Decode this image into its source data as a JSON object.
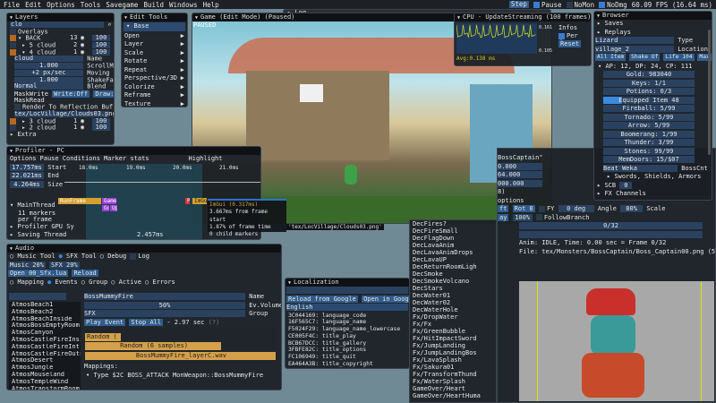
{
  "menu": {
    "items": [
      "File",
      "Edit",
      "Options",
      "Tools",
      "Savegame",
      "Build",
      "Windows",
      "Help"
    ],
    "step": "Step",
    "pause": "Pause",
    "nomon": "NoMon",
    "nodmg": "NoDmg",
    "fps": "60.09 FPS (16.64 ms)"
  },
  "layers": {
    "title": "Layers",
    "search": "clo",
    "overlays": "Overlays",
    "rows": [
      {
        "name": "BACK",
        "count": "13",
        "value": "100"
      },
      {
        "name": "5 cloud",
        "count": "2",
        "value": "100"
      },
      {
        "name": "4 cloud",
        "count": "1",
        "value": "100"
      }
    ],
    "name_val": "cloud",
    "name_lbl": "Name",
    "scroll_val": "1.000",
    "scroll_lbl": "ScrollMulX",
    "moving_val": "+2 px/sec",
    "moving_lbl": "Moving Spe",
    "shake_val": "1.000",
    "shake_lbl": "ShakeFacto",
    "blend_val": "Normal",
    "blend_lbl": "Blend",
    "maskwrite": "MaskWrite",
    "write_off": "Write:Off",
    "draw": "Draw:O",
    "maskread": "MaskRead",
    "render_reflection": "Render To Reflection Buffer",
    "texture": "tex/LocVillage/Clouds03.png",
    "rows2": [
      {
        "name": "3 cloud",
        "count": "1",
        "value": "100"
      },
      {
        "name": "2 cloud",
        "count": "1",
        "value": "100"
      }
    ],
    "extra": "Extra"
  },
  "edit_tools": {
    "title": "Edit Tools",
    "base": "Base",
    "items": [
      "Open",
      "Layer",
      "Scale",
      "Rotate",
      "Repeat",
      "Perspective/3D",
      "Colorize",
      "Reframe",
      "Texture",
      "Behavior"
    ]
  },
  "game": {
    "title": "Game (Edit Mode) (Paused)",
    "paused": "PAUSED",
    "log_tab": "Log"
  },
  "cpu": {
    "title": "CPU - UpdateStreaming (100 frames)",
    "max": "0.161",
    "min": "0.105",
    "avg": "Avg:0.138 ms",
    "infos": "Infos",
    "per_frame": "Per frame",
    "reset": "Reset",
    "color": "#c8d020"
  },
  "browser": {
    "title": "Browser",
    "saves": "Saves",
    "replays": "Replays",
    "type_val": "Lizard",
    "type_lbl": "Type",
    "loc_val": "village_2",
    "loc_lbl": "Location",
    "buttons": [
      "All Item",
      "Shake Of",
      "Life 104",
      "Max 104"
    ],
    "stats": "AP: 12, DP: 24, CP: 111",
    "items": [
      "Gold: 983040",
      "Keys: 1/1",
      "Potions: 0/3",
      "Equipped Item 48",
      "Fireball: 5/99",
      "Tornado: 5/99",
      "Arrow: 5/99",
      "Boomerang: 1/99",
      "Thunder: 3/99",
      "Stones: 99/99",
      "MemDoors: 15/$07"
    ],
    "boss_val": "Beat Weka",
    "boss_lbl": "BossCnt",
    "swords": "Swords, Shields, Armors",
    "scb": "SCB",
    "scb_val": "0",
    "fx": "FX Channels"
  },
  "profiler": {
    "title": "Profiler - PC",
    "menu": [
      "Options",
      "Pause Conditions",
      "Marker stats",
      "Highlight"
    ],
    "start": "17.757ms",
    "start_lbl": "Start",
    "end": "22.021ms",
    "end_lbl": "End",
    "size": "4.264ms",
    "size_lbl": "Size",
    "ticks": [
      "18.0ms",
      "19.0ms",
      "20.0ms",
      "21.0ms"
    ],
    "main_thread": "MainThread",
    "markers": "11 markers",
    "per_frame": "per frame",
    "gpu": "Profiler GPU Sy",
    "saving": "Saving Thread",
    "duration": "2.457ms",
    "bars": {
      "runframe": "RunFrame",
      "game": "Game",
      "goup": "Go",
      "up": "Up",
      "p": "P",
      "imgui": "ImGu"
    }
  },
  "tooltip": {
    "title": "ImGui (0.317ms)",
    "l1": "3.667ms from frame start",
    "l2": "1.87% of frame time",
    "l3": "0 child markers",
    "extra": "'tex/LocVillage/Clouds03.png'"
  },
  "audio": {
    "title": "Audio",
    "tabs": [
      "Music Tool",
      "SFX Tool",
      "Debug",
      "Log"
    ],
    "music": "Music 20%",
    "sfx": "SFX 20%",
    "open": "Open 00_Sfx.lua",
    "reload": "Reload",
    "modes": [
      "Mapping",
      "Events",
      "Group",
      "Active",
      "Errors"
    ],
    "search": "",
    "list": [
      "AtmosBeach1",
      "AtmosBeach2",
      "AtmosBeachInside",
      "AtmosBossEmptyRoom",
      "AtmosCanyon",
      "AtmosCastleFireInsi",
      "AtmosCastleFireIntr",
      "AtmosCastleFireOuts",
      "AtmosDesert",
      "AtmosJungle",
      "AtmosMouseland",
      "AtmosTempleWind",
      "AtmosTransformRoom"
    ],
    "name_val": "BossMummyFire",
    "name_lbl": "Name",
    "vol_val": "50%",
    "vol_lbl": "Ev.Volume",
    "group_val": "SFX",
    "group_lbl": "Group",
    "play": "Play Event",
    "stop": "Stop All",
    "time": "- 2.97 sec",
    "help": "(?)",
    "track1": "Random (",
    "track2": "Random (6 samples)",
    "track3": "BossMummyFire_layerC.wav",
    "mappings": "Mappings:",
    "mapping": "Type $2C BOSS_ATTACK    MonWeapon::BossMummyFire",
    "track_color": "#d4a04a"
  },
  "localization": {
    "title": "Localization",
    "reload": "Reload from Google",
    "open": "Open in Google",
    "lang": "English",
    "rows": [
      [
        "3C044169:",
        "language_code"
      ],
      [
        "16F565C7:",
        "language_name"
      ],
      [
        "F5024F29:",
        "language_name_lowercase"
      ],
      [
        "CE005F4C:",
        "title_play"
      ],
      [
        "BCB67DCC:",
        "title_gallery"
      ],
      [
        "3FBFE82C:",
        "title_options"
      ],
      [
        "FC106949:",
        "title_quit"
      ],
      [
        "EA464A3B:",
        "title_copyright"
      ]
    ]
  },
  "sprites": {
    "list": [
      "DecFires?",
      "DecFireSmall",
      "DecFlagDown",
      "DecLavaAnim",
      "DecLavaAnimDrops",
      "DecLavaUP",
      "DecReturnRoomLigh",
      "DecSmoke",
      "DecSmokeVolcano",
      "DecStars",
      "DecWater01",
      "DecWater02",
      "DecWaterHole",
      "Fx/DropWater",
      "Fx/Fx",
      "Fx/GreenBubble",
      "Fx/HitImpactSword",
      "Fx/JumpLanding",
      "Fx/JumpLandingBos",
      "Fx/LavaSplash",
      "Fx/Sakura01",
      "Fx/TransformThund",
      "Fx/WaterSplash",
      "GameOver/Heart",
      "GameOver/HeartHuma"
    ]
  },
  "sprite_editor": {
    "name": "BossCaptain\"",
    "f1": "0.000",
    "f2": "64.000",
    "f3": "000.000",
    "f4": "8)",
    "options": "options",
    "left": "ft",
    "rot": "Rot 0",
    "fy": "FY",
    "deg": "0 deg",
    "angle": "Angle",
    "scale_val": "80%",
    "scale": "Scale",
    "play": "ay",
    "pct": "100%",
    "follow": "FollowBranch",
    "frame": "0/32",
    "anim": "Anim: IDLE, Time:  0.00 sec = Frame 0/32",
    "file": "File: tex/Monsters/BossCaptain/Boss_Captain00.png (546x573)"
  }
}
